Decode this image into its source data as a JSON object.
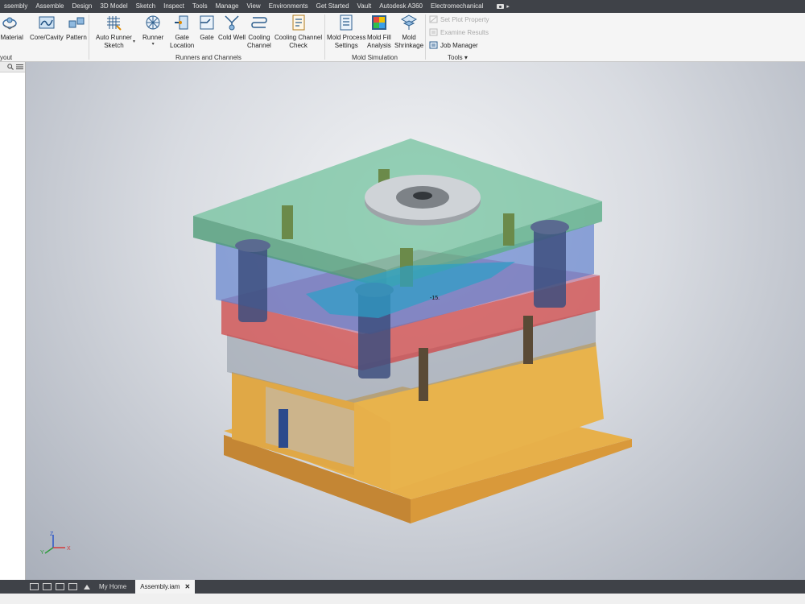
{
  "tabs": [
    {
      "label": "ssembly",
      "active": false
    },
    {
      "label": "Assemble",
      "active": false
    },
    {
      "label": "Design",
      "active": false
    },
    {
      "label": "3D Model",
      "active": false
    },
    {
      "label": "Sketch",
      "active": false
    },
    {
      "label": "Inspect",
      "active": false
    },
    {
      "label": "Tools",
      "active": false
    },
    {
      "label": "Manage",
      "active": false
    },
    {
      "label": "View",
      "active": false
    },
    {
      "label": "Environments",
      "active": false
    },
    {
      "label": "Get Started",
      "active": false
    },
    {
      "label": "Vault",
      "active": false
    },
    {
      "label": "Autodesk A360",
      "active": false
    },
    {
      "label": "Electromechanical",
      "active": false
    }
  ],
  "ribbon": {
    "material_label": "t Material",
    "core_cavity_label": "Core/Cavity",
    "pattern_label": "Pattern",
    "layout_panel_label": "yout",
    "auto_runner_line1": "Auto Runner",
    "auto_runner_line2": "Sketch",
    "runner_label": "Runner",
    "gate_location_line1": "Gate",
    "gate_location_line2": "Location",
    "gate_label": "Gate",
    "cold_well_label": "Cold Well",
    "cooling_channel_line1": "Cooling",
    "cooling_channel_line2": "Channel",
    "cooling_check_line1": "Cooling Channel",
    "cooling_check_line2": "Check",
    "runners_panel_label": "Runners and Channels",
    "mold_process_line1": "Mold Process",
    "mold_process_line2": "Settings",
    "mold_fill_line1": "Mold Fill",
    "mold_fill_line2": "Analysis",
    "mold_shrinkage_line1": "Mold",
    "mold_shrinkage_line2": "Shrinkage",
    "mold_sim_panel_label": "Mold Simulation",
    "set_plot_property": "Set Plot Property",
    "examine_results": "Examine Results",
    "job_manager": "Job Manager",
    "tools_panel_label": "Tools"
  },
  "viewport": {
    "dimension_text": "-15."
  },
  "axis": {
    "z": "Z",
    "y": "Y",
    "x": "X"
  },
  "document_tabs": {
    "home": "My Home",
    "assembly": "Assembly.iam",
    "close_glyph": "✕"
  },
  "colors": {
    "top_plate": "#5aa77f",
    "cavity_plate": "#5f7fc3",
    "core_plate": "#d14b4b",
    "base": "#e7b04a"
  }
}
